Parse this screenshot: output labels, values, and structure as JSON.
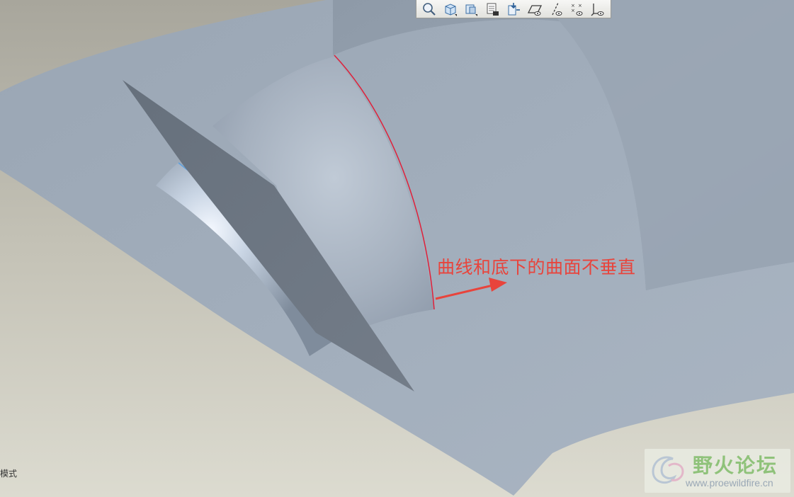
{
  "viewport": {
    "annotation_text": "曲线和底下的曲面不垂直",
    "mode_label": "模式",
    "colors": {
      "background": "#c9c7bb",
      "surface": "#98a6b6",
      "plane": "#6b7480",
      "curve": "#e0203a",
      "annotation": "#e8443c"
    }
  },
  "toolbar": {
    "buttons": [
      {
        "id": "zoom",
        "icon": "zoom-icon"
      },
      {
        "id": "view-cube",
        "icon": "view-cube-icon"
      },
      {
        "id": "saved-views",
        "icon": "saved-views-icon"
      },
      {
        "id": "layers",
        "icon": "layers-icon"
      },
      {
        "id": "regenerate",
        "icon": "regenerate-icon"
      },
      {
        "id": "datum-planes",
        "icon": "datum-plane-icon"
      },
      {
        "id": "datum-axes",
        "icon": "datum-axis-icon"
      },
      {
        "id": "datum-points",
        "icon": "datum-point-icon"
      },
      {
        "id": "coordinate-systems",
        "icon": "coordinate-system-icon"
      }
    ]
  },
  "watermark": {
    "title": "野火论坛",
    "url": "www.proewildfire.cn"
  }
}
